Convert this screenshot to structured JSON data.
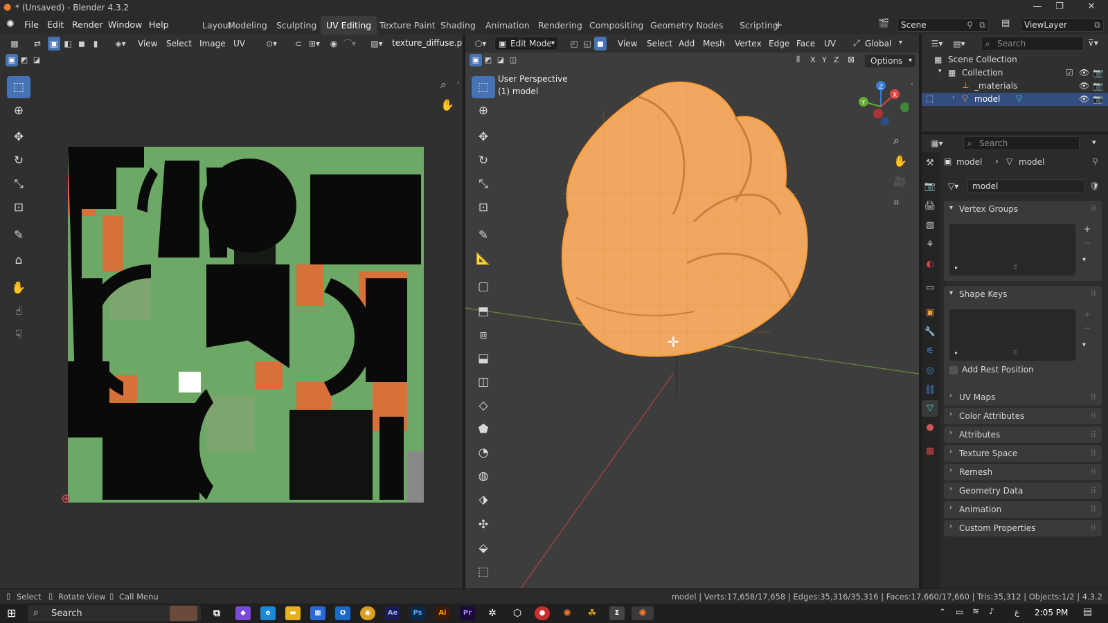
{
  "window": {
    "title": "* (Unsaved) - Blender 4.3.2",
    "minimize": "—",
    "maximize": "❐",
    "close": "✕"
  },
  "menubar": {
    "items": [
      "File",
      "Edit",
      "Render",
      "Window",
      "Help"
    ],
    "workspaces": [
      "Layout",
      "Modeling",
      "Sculpting",
      "UV Editing",
      "Texture Paint",
      "Shading",
      "Animation",
      "Rendering",
      "Compositing",
      "Geometry Nodes",
      "Scripting"
    ],
    "active_workspace": "UV Editing",
    "add_workspace": "+",
    "scene": "Scene",
    "view_layer": "ViewLayer"
  },
  "uv_editor": {
    "menus": [
      "View",
      "Select",
      "Image",
      "UV"
    ],
    "image_name": "texture_diffuse.png"
  },
  "viewport": {
    "mode": "Edit Mode",
    "menus": [
      "View",
      "Select",
      "Add",
      "Mesh",
      "Vertex",
      "Edge",
      "Face",
      "UV"
    ],
    "orientation": "Global",
    "options": "Options",
    "axis_buttons": [
      "X",
      "Y",
      "Z"
    ],
    "overlay_title": "User Perspective",
    "overlay_subtitle": "(1) model",
    "gizmo": {
      "x": "X",
      "y": "Y",
      "z": "Z"
    }
  },
  "outliner": {
    "search_placeholder": "Search",
    "rows": [
      {
        "label": "Scene Collection"
      },
      {
        "label": "Collection"
      },
      {
        "label": "_materials"
      },
      {
        "label": "model"
      }
    ]
  },
  "properties": {
    "search_placeholder": "Search",
    "breadcrumb_object": "model",
    "breadcrumb_data": "model",
    "data_name": "model",
    "vertex_groups": "Vertex Groups",
    "shape_keys": "Shape Keys",
    "add_rest_position": "Add Rest Position",
    "add_rest_position_checked": false,
    "collapsed_panels": [
      "UV Maps",
      "Color Attributes",
      "Attributes",
      "Texture Space",
      "Remesh",
      "Geometry Data",
      "Animation",
      "Custom Properties"
    ]
  },
  "statusbar": {
    "select": "Select",
    "rotate": "Rotate View",
    "call_menu": "Call Menu",
    "stats": "model | Verts:17,658/17,658 | Edges:35,316/35,316 | Faces:17,660/17,660 | Tris:35,312 | Objects:1/2 | 4.3.2"
  },
  "taskbar": {
    "search": "Search",
    "time": "2:05 PM",
    "lang": "ع"
  },
  "colors": {
    "accent": "#4772b3",
    "mesh_orange": "#f0a860",
    "uv_green": "#6ea867",
    "uv_orange": "#d8703a"
  }
}
